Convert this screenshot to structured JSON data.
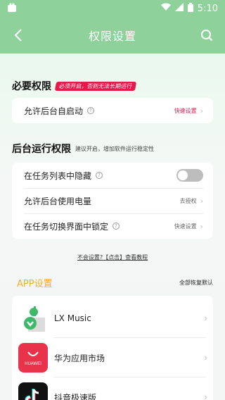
{
  "status": {
    "time": "5:10"
  },
  "header": {
    "title": "权限设置"
  },
  "required": {
    "title": "必要权限",
    "badge": "必须开启，否则无法长期运行",
    "items": [
      {
        "label": "允许后台自启动",
        "action": "快速设置"
      }
    ]
  },
  "background": {
    "title": "后台运行权限",
    "note": "建议开启，增加软件运行稳定性",
    "items": [
      {
        "label": "在任务列表中隐藏",
        "toggle": false
      },
      {
        "label": "允许后台使用电量",
        "action": "去授权"
      },
      {
        "label": "在任务切换界面中锁定",
        "action": "快速设置"
      }
    ]
  },
  "help": {
    "prefix": "不会设置?",
    "link": "【点击】查看教程"
  },
  "apps": {
    "title": "APP设置",
    "reset": "全部恢复默认",
    "items": [
      {
        "name": "LX Music",
        "icon": "lx-music-icon"
      },
      {
        "name": "华为应用市场",
        "icon": "huawei-appgallery-icon",
        "icon_text": "HUAWEI"
      },
      {
        "name": "抖音极速版",
        "icon": "douyin-icon"
      }
    ]
  },
  "colors": {
    "header": "#8fd19a",
    "accent_red": "#e5194b",
    "app_title": "#f0b030"
  }
}
